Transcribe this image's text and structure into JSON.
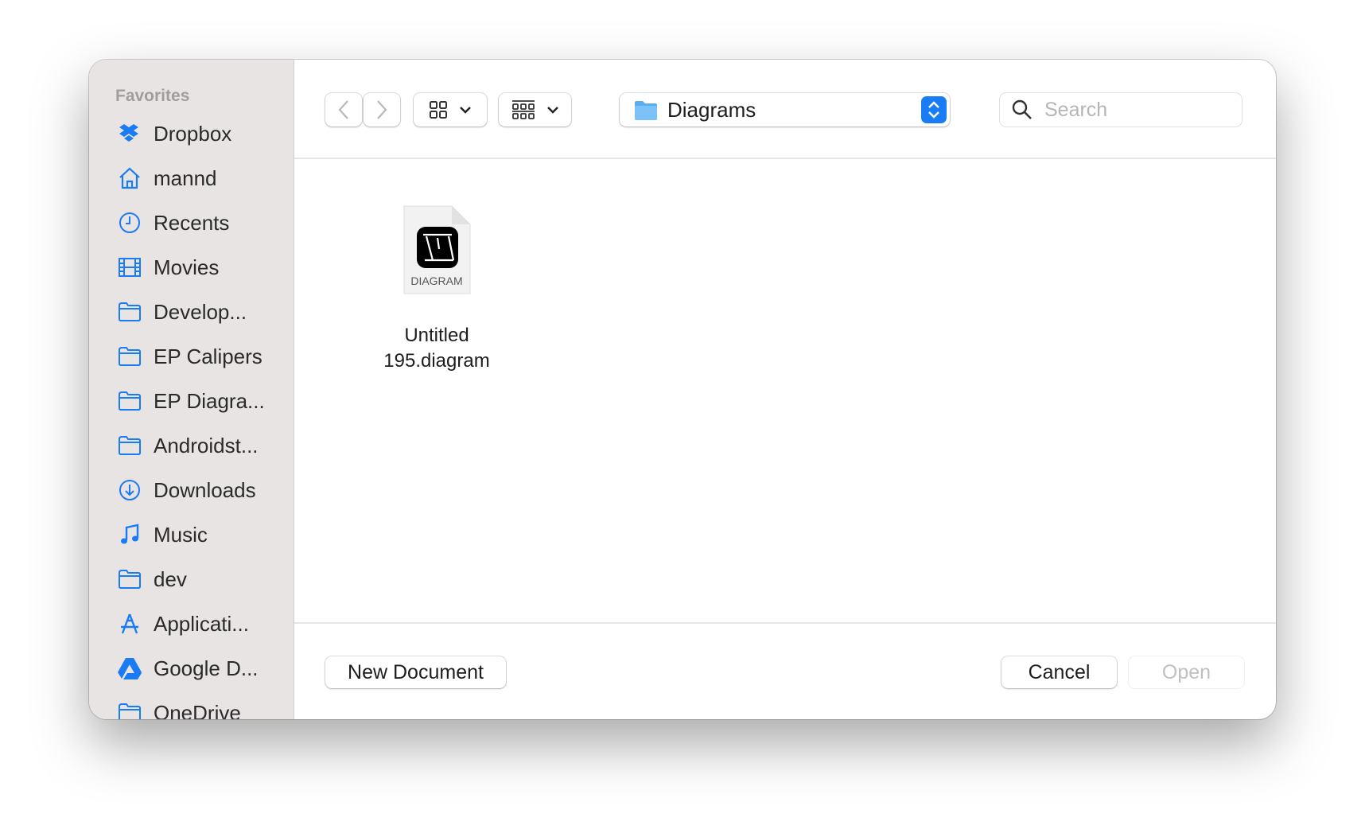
{
  "sidebar": {
    "section": "Favorites",
    "items": [
      {
        "label": "Dropbox",
        "icon": "dropbox-icon"
      },
      {
        "label": "mannd",
        "icon": "home-icon"
      },
      {
        "label": "Recents",
        "icon": "clock-icon"
      },
      {
        "label": "Movies",
        "icon": "film-icon"
      },
      {
        "label": "Develop...",
        "icon": "folder-icon"
      },
      {
        "label": "EP Calipers",
        "icon": "folder-icon"
      },
      {
        "label": "EP Diagra...",
        "icon": "folder-icon"
      },
      {
        "label": "Androidst...",
        "icon": "folder-icon"
      },
      {
        "label": "Downloads",
        "icon": "download-icon"
      },
      {
        "label": "Music",
        "icon": "music-icon"
      },
      {
        "label": "dev",
        "icon": "folder-icon"
      },
      {
        "label": "Applicati...",
        "icon": "applications-icon"
      },
      {
        "label": "Google D...",
        "icon": "google-drive-icon"
      },
      {
        "label": "OneDrive",
        "icon": "folder-icon"
      }
    ]
  },
  "toolbar": {
    "location": "Diagrams",
    "search_placeholder": "Search"
  },
  "files": [
    {
      "name_line1": "Untitled",
      "name_line2": "195.diagram",
      "badge": "DIAGRAM"
    }
  ],
  "footer": {
    "new_document": "New Document",
    "cancel": "Cancel",
    "open": "Open"
  },
  "colors": {
    "accent": "#1a7cf5",
    "sidebar": "#e8e4e3"
  }
}
